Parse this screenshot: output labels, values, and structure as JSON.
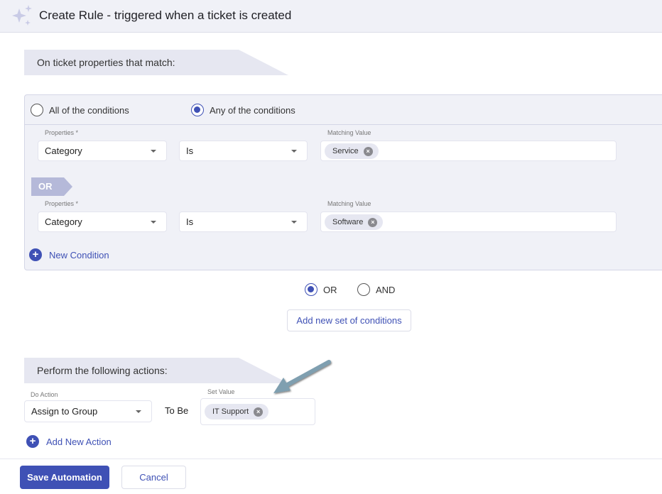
{
  "header": {
    "title": "Create Rule - triggered when a ticket is created",
    "icon": "sparkle-icon"
  },
  "conditions": {
    "banner": "On ticket properties that match:",
    "match_mode": {
      "options": [
        {
          "label": "All of the conditions",
          "selected": false
        },
        {
          "label": "Any of the conditions",
          "selected": true
        }
      ]
    },
    "rows": [
      {
        "property_label": "Properties *",
        "property": "Category",
        "operator": "Is",
        "value_label": "Matching Value",
        "values": [
          "Service"
        ]
      },
      {
        "property_label": "Properties *",
        "property": "Category",
        "operator": "Is",
        "value_label": "Matching Value",
        "values": [
          "Software"
        ]
      }
    ],
    "joiner": "OR",
    "new_condition": "New Condition"
  },
  "set_logic": {
    "options": [
      {
        "label": "OR",
        "selected": true
      },
      {
        "label": "AND",
        "selected": false
      }
    ],
    "add_set": "Add new set of conditions"
  },
  "actions": {
    "banner": "Perform the following actions:",
    "do_action_label": "Do Action",
    "do_action": "Assign to Group",
    "to_be": "To Be",
    "set_value_label": "Set Value",
    "values": [
      "IT Support"
    ],
    "add_action": "Add New Action"
  },
  "footer": {
    "save": "Save Automation",
    "cancel": "Cancel"
  },
  "colors": {
    "accent": "#3f51b5",
    "panel": "#f0f1f7",
    "banner": "#e6e7f1",
    "arrow": "#7f9fb0"
  }
}
